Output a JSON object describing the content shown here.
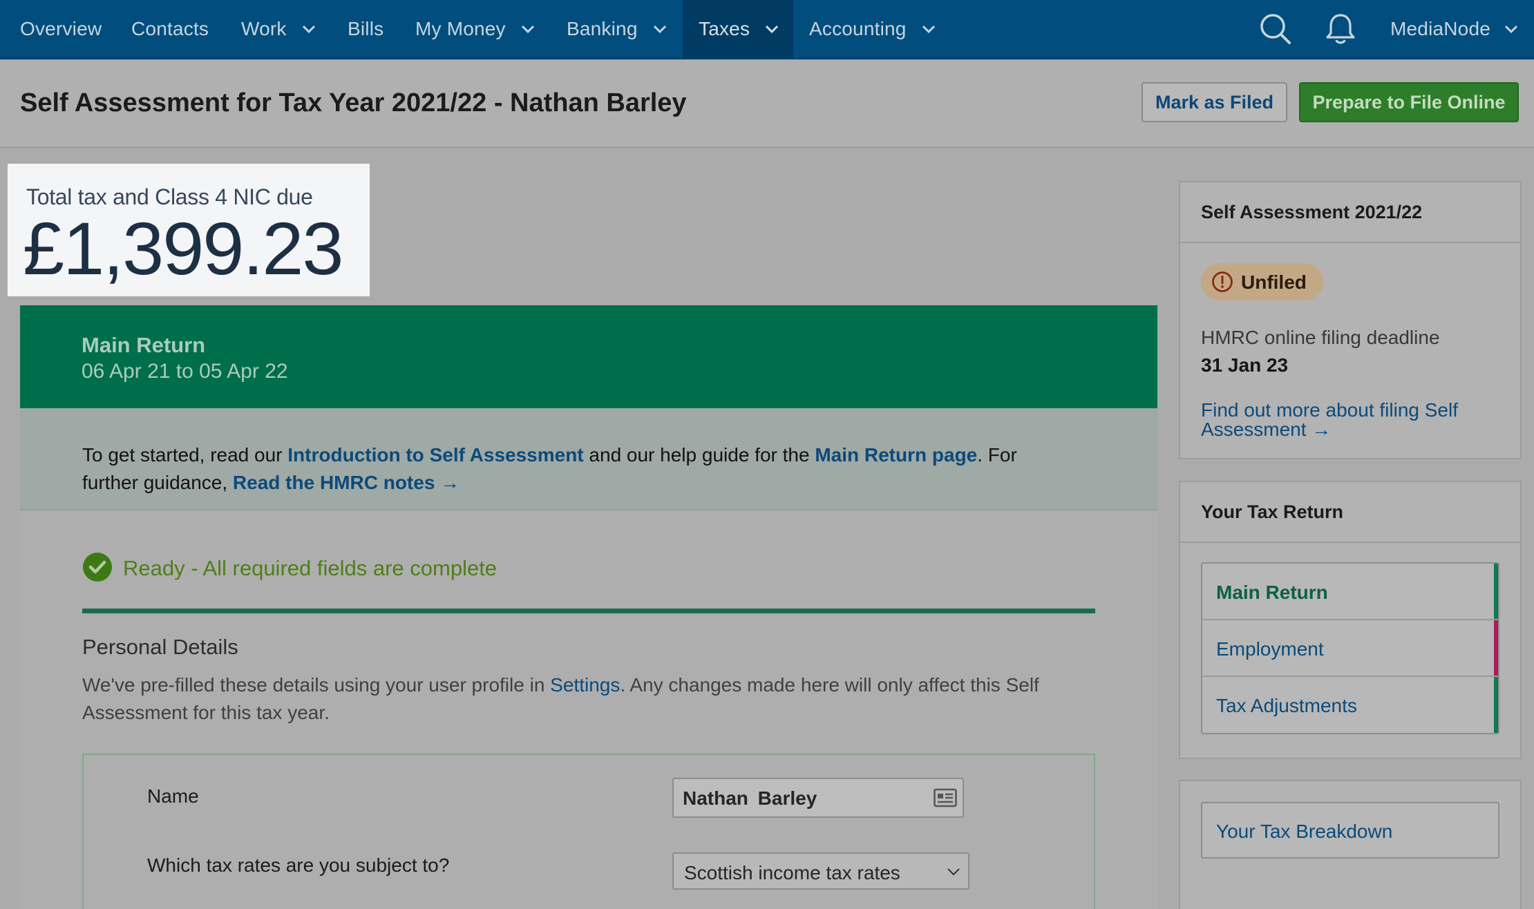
{
  "nav": {
    "items": [
      {
        "label": "Overview",
        "has_dropdown": false,
        "active": false
      },
      {
        "label": "Contacts",
        "has_dropdown": false,
        "active": false
      },
      {
        "label": "Work",
        "has_dropdown": true,
        "active": false
      },
      {
        "label": "Bills",
        "has_dropdown": false,
        "active": false
      },
      {
        "label": "My Money",
        "has_dropdown": true,
        "active": false
      },
      {
        "label": "Banking",
        "has_dropdown": true,
        "active": false
      },
      {
        "label": "Taxes",
        "has_dropdown": true,
        "active": true
      },
      {
        "label": "Accounting",
        "has_dropdown": true,
        "active": false
      }
    ],
    "search_icon": "search-icon",
    "notifications_icon": "bell-icon",
    "account_label": "MediaNode"
  },
  "page": {
    "title": "Self Assessment for Tax Year 2021/22 - Nathan Barley",
    "mark_filed_label": "Mark as Filed",
    "prepare_label": "Prepare to File Online"
  },
  "total": {
    "label": "Total tax and Class 4 NIC due",
    "amount": "£1,399.23"
  },
  "banner": {
    "title": "Main Return",
    "dates": "06 Apr 21 to 05 Apr 22"
  },
  "intro": {
    "part1": "To get started, read our ",
    "link1": "Introduction to Self Assessment",
    "part2": " and our help guide for the ",
    "link2": "Main Return page",
    "part3": ". For further guidance, ",
    "link3": "Read the HMRC notes →"
  },
  "status": {
    "ready_text": "Ready - All required fields are complete"
  },
  "personal": {
    "heading": "Personal Details",
    "desc_part1": "We've pre-filled these details using your user profile in ",
    "desc_link": "Settings",
    "desc_part2": ". Any changes made here will only affect this Self Assessment for this tax year.",
    "name_label": "Name",
    "name_value": "Nathan  Barley",
    "rates_label": "Which tax rates are you subject to?",
    "rates_value": "Scottish income tax rates"
  },
  "sidebar": {
    "sa_title": "Self Assessment 2021/22",
    "badge": "Unfiled",
    "deadline_label": "HMRC online filing deadline",
    "deadline_date": "31 Jan 23",
    "filing_link": "Find out more about filing Self Assessment →",
    "tax_return_title": "Your Tax Return",
    "tax_return_items": [
      {
        "label": "Main Return",
        "active": true,
        "accent": "#0d7a54"
      },
      {
        "label": "Employment",
        "active": false,
        "accent": "#b0175e"
      },
      {
        "label": "Tax Adjustments",
        "active": false,
        "accent": "#0d7a54"
      }
    ],
    "breakdown_label": "Your Tax Breakdown"
  },
  "colors": {
    "nav_bg": "#004d7e",
    "banner_green": "#006e4a",
    "primary_button": "#2e7d2a",
    "link": "#0c4a79"
  }
}
